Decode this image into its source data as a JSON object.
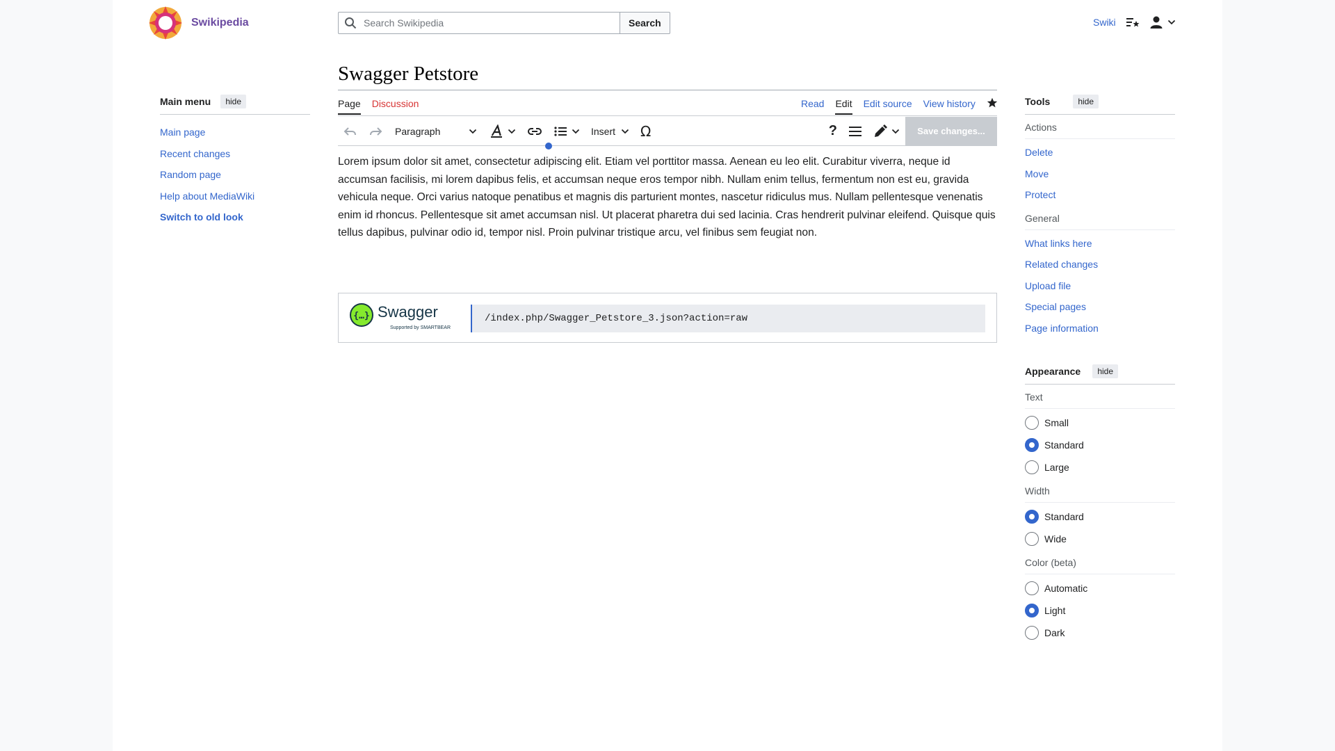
{
  "header": {
    "site_name": "Swikipedia",
    "search_placeholder": "Search Swikipedia",
    "search_button": "Search",
    "user_link": "Swiki"
  },
  "main_menu": {
    "title": "Main menu",
    "hide_label": "hide",
    "items": [
      {
        "label": "Main page"
      },
      {
        "label": "Recent changes"
      },
      {
        "label": "Random page"
      },
      {
        "label": "Help about MediaWiki"
      },
      {
        "label": "Switch to old look"
      }
    ]
  },
  "page": {
    "title": "Swagger Petstore",
    "tabs_left": [
      {
        "label": "Page"
      },
      {
        "label": "Discussion"
      }
    ],
    "tabs_right": [
      {
        "label": "Read"
      },
      {
        "label": "Edit"
      },
      {
        "label": "Edit source"
      },
      {
        "label": "View history"
      }
    ]
  },
  "toolbar": {
    "paragraph": "Paragraph",
    "insert": "Insert",
    "save": "Save changes..."
  },
  "content": {
    "paragraph": "Lorem ipsum dolor sit amet, consectetur adipiscing elit. Etiam vel porttitor massa. Aenean eu leo elit. Curabitur viverra, neque id accumsan facilisis, mi lorem dapibus felis, et accumsan neque eros tempor nibh. Nullam enim tellus, fermentum non est eu, gravida vehicula neque. Orci varius natoque penatibus et magnis dis parturient montes, nascetur ridiculus mus. Nullam pellentesque venenatis enim id rhoncus. Pellentesque sit amet accumsan nisl. Ut placerat pharetra dui sed lacinia. Cras hendrerit pulvinar eleifend. Quisque quis tellus dapibus, pulvinar odio id, tempor nisl. Proin pulvinar tristique arcu, vel finibus sem feugiat non.",
    "swagger_name": "Swagger",
    "swagger_sub": "Supported by SMARTBEAR",
    "swagger_url": "/index.php/Swagger_Petstore_3.json?action=raw"
  },
  "tools": {
    "title": "Tools",
    "hide_label": "hide",
    "actions_label": "Actions",
    "actions": [
      {
        "label": "Delete"
      },
      {
        "label": "Move"
      },
      {
        "label": "Protect"
      }
    ],
    "general_label": "General",
    "general": [
      {
        "label": "What links here"
      },
      {
        "label": "Related changes"
      },
      {
        "label": "Upload file"
      },
      {
        "label": "Special pages"
      },
      {
        "label": "Page information"
      }
    ]
  },
  "appearance": {
    "title": "Appearance",
    "hide_label": "hide",
    "text_label": "Text",
    "text_options": [
      {
        "label": "Small",
        "checked": false
      },
      {
        "label": "Standard",
        "checked": true
      },
      {
        "label": "Large",
        "checked": false
      }
    ],
    "width_label": "Width",
    "width_options": [
      {
        "label": "Standard",
        "checked": true
      },
      {
        "label": "Wide",
        "checked": false
      }
    ],
    "color_label": "Color (beta)",
    "color_options": [
      {
        "label": "Automatic",
        "checked": false
      },
      {
        "label": "Light",
        "checked": true
      },
      {
        "label": "Dark",
        "checked": false
      }
    ]
  },
  "colors": {
    "link": "#3366cc",
    "red_link": "#d73333",
    "brand": "#6b4ba1"
  }
}
